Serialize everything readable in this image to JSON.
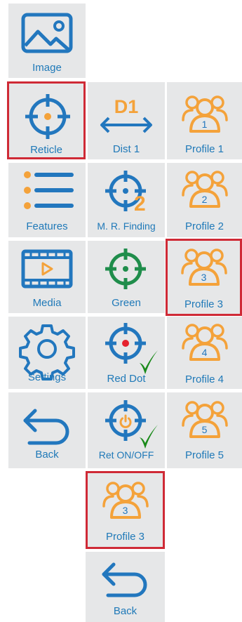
{
  "colors": {
    "blue": "#2277be",
    "orange": "#f4a23a",
    "green": "#1f8d4b",
    "red": "#e5222e",
    "check": "#1a8a1a",
    "selection": "#cf2a36",
    "tile": "#e6e7e8"
  },
  "col1": {
    "image": "Image",
    "reticle": "Reticle",
    "features": "Features",
    "media": "Media",
    "settings": "Settings",
    "back": "Back"
  },
  "col2": {
    "dist_icon_text": "D1",
    "dist": "Dist 1",
    "mr_icon_text": "2",
    "mr": "M. R. Finding",
    "green": "Green",
    "red_dot": "Red Dot",
    "ret_onoff": "Ret ON/OFF"
  },
  "col3": [
    {
      "num": "1",
      "label": "Profile 1"
    },
    {
      "num": "2",
      "label": "Profile 2"
    },
    {
      "num": "3",
      "label": "Profile 3"
    },
    {
      "num": "4",
      "label": "Profile 4"
    },
    {
      "num": "5",
      "label": "Profile 5"
    }
  ],
  "bottom": {
    "profile_num": "3",
    "profile_label": "Profile 3",
    "back": "Back"
  }
}
